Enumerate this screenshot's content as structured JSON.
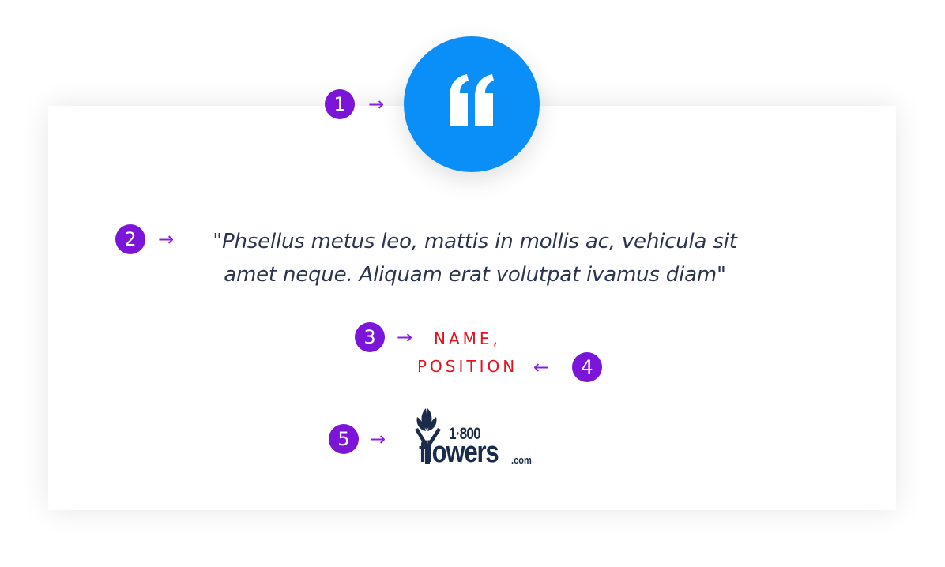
{
  "testimonial": {
    "quote_line1": "\"Phsellus metus leo, mattis in mollis ac, vehicula sit",
    "quote_line2": "amet neque. Aliquam erat volutpat ivamus diam\"",
    "name": "NAME,",
    "position": "POSITION"
  },
  "logo": {
    "number": "1·800",
    "word": "flowers",
    "suffix": ".com"
  },
  "callouts": [
    {
      "label": "1",
      "arrow": "→"
    },
    {
      "label": "2",
      "arrow": "→"
    },
    {
      "label": "3",
      "arrow": "→"
    },
    {
      "label": "4",
      "arrow": "←"
    },
    {
      "label": "5",
      "arrow": "→"
    }
  ],
  "icons": {
    "quote": "quote-icon",
    "logo_mark": "tulip-icon"
  },
  "colors": {
    "accent_blue": "#0a8ef7",
    "callout_purple": "#7b16d9",
    "name_red": "#e8111b",
    "quote_text": "#2b3450",
    "logo_navy": "#1b2b4b"
  }
}
